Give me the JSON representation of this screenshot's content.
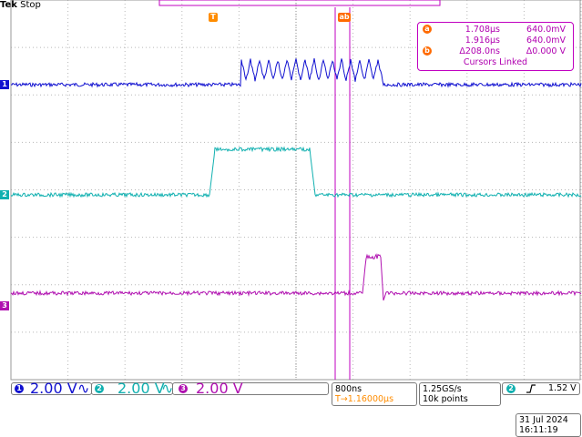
{
  "status": {
    "brand": "Tek",
    "state": "Stop"
  },
  "colors": {
    "ch1": "#1010d0",
    "ch2": "#10b0b0",
    "ch3": "#b010b0",
    "cursor": "#c000c0",
    "trigger": "#ff8c00",
    "grid": "#b8b8b8"
  },
  "markers": {
    "trigger_top": "T",
    "cursor_top": "ab",
    "ch1": "1",
    "ch2": "2",
    "ch3": "3"
  },
  "cursor_readout": {
    "a_label": "a",
    "a_time": "1.708µs",
    "a_volt": "640.0mV",
    "b_time": "1.916µs",
    "b_volt": "640.0mV",
    "b_label": "b",
    "delta_time": "Δ208.0ns",
    "delta_volt": "Δ0.000 V",
    "linked": "Cursors Linked"
  },
  "channels": [
    {
      "num": "1",
      "scale": "2.00 V",
      "coupling": "∿"
    },
    {
      "num": "2",
      "scale": "2.00 V",
      "coupling": "∿"
    },
    {
      "num": "3",
      "scale": "2.00 V"
    }
  ],
  "horizontal": {
    "timebase": "800ns",
    "trigger_pos": "T→1.16000µs"
  },
  "acquisition": {
    "sample_rate": "1.25GS/s",
    "record_length": "10k points"
  },
  "trigger": {
    "source": "2",
    "slope_icon": "rising-edge",
    "level": "1.52 V"
  },
  "datetime": {
    "date": "31 Jul  2024",
    "time": "16:11:19"
  }
}
